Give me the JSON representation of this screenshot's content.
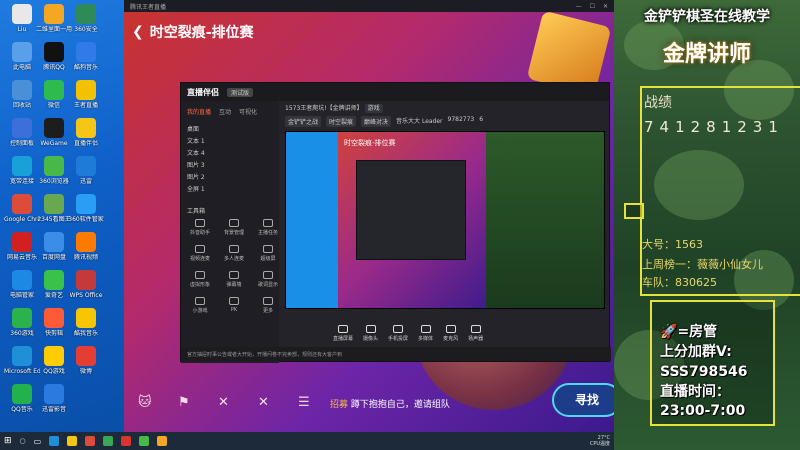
{
  "desktop": {
    "icons": [
      {
        "label": "Liu",
        "color": "#e8e8e8"
      },
      {
        "label": "二维里面一用",
        "color": "#f5a623"
      },
      {
        "label": "360安全",
        "color": "#2e8b57"
      },
      {
        "label": "此电脑",
        "color": "#5aa0e8"
      },
      {
        "label": "腾讯QQ",
        "color": "#111111"
      },
      {
        "label": "酷狗音乐",
        "color": "#2f7be8"
      },
      {
        "label": "回收站",
        "color": "#4a90d9"
      },
      {
        "label": "微信",
        "color": "#2dbb4e"
      },
      {
        "label": "王者直播",
        "color": "#f2c200"
      },
      {
        "label": "控制面板",
        "color": "#3c6fd8"
      },
      {
        "label": "WeGame",
        "color": "#1d1d1d"
      },
      {
        "label": "直播伴侣",
        "color": "#f5c518"
      },
      {
        "label": "宽带连接",
        "color": "#1aa0d8"
      },
      {
        "label": "360浏览器",
        "color": "#48b848"
      },
      {
        "label": "迅雷",
        "color": "#1f7bd8"
      },
      {
        "label": "Google Chrome",
        "color": "#dd4b39"
      },
      {
        "label": "2345看图王",
        "color": "#6aa84f"
      },
      {
        "label": "360软件管家",
        "color": "#2a9df4"
      },
      {
        "label": "网易云音乐",
        "color": "#d21f1f"
      },
      {
        "label": "百度网盘",
        "color": "#3b8ee8"
      },
      {
        "label": "腾讯视频",
        "color": "#ff7a00"
      },
      {
        "label": "电脑管家",
        "color": "#1e88e5"
      },
      {
        "label": "爱奇艺",
        "color": "#39c24a"
      },
      {
        "label": "WPS Office",
        "color": "#c43a3a"
      },
      {
        "label": "360游戏",
        "color": "#2bb24c"
      },
      {
        "label": "快剪辑",
        "color": "#ff5a36"
      },
      {
        "label": "酷我音乐",
        "color": "#f6c600"
      },
      {
        "label": "Microsoft Edge",
        "color": "#1f8fd8"
      },
      {
        "label": "QQ游戏",
        "color": "#ffcc00"
      },
      {
        "label": "微博",
        "color": "#e43d33"
      },
      {
        "label": "QQ音乐",
        "color": "#22b14c"
      },
      {
        "label": "迅雷影音",
        "color": "#2a7be0"
      }
    ]
  },
  "game": {
    "window_title": "腾讯王者直播",
    "back_icon": "chevron-left-icon",
    "title": "时空裂痕-排位赛",
    "invite_prefix": "招募",
    "invite_text": "蹲下抱抱自己，邀请组队",
    "match_button": "寻找"
  },
  "stream_app": {
    "logo": "直播伴侣",
    "version_badge": "测试版",
    "tabs": [
      "我的直播",
      "互动",
      "可视化"
    ],
    "sources": [
      "桌面",
      "文本 1",
      "文本 4",
      "图片 3",
      "图片 2",
      "全屏 1"
    ],
    "tools_title": "工具箱",
    "tools": [
      "抖音助手",
      "背景管理",
      "主播任务",
      "视频连麦",
      "多人连麦",
      "超级屏",
      "虚拟形象",
      "弹幕墙",
      "歌词显示",
      "小游戏",
      "PK",
      "更多"
    ],
    "room_title": "1573王者爬坑!【金牌讲师】",
    "room_tag": "游戏",
    "tags": [
      "金铲铲之战",
      "时空裂痕",
      "巅峰对决"
    ],
    "stats_text": "音乐大大 Leader",
    "viewers": "9782773",
    "likes": "6",
    "preview_title": "时空裂痕-排位赛",
    "controls": [
      "直播屏幕",
      "摄像头",
      "手机投屏",
      "多媒体",
      "麦克风",
      "扬声器"
    ],
    "notice": "官方抽屉时事公告或者大开始，开播问卷不完卖部，规则还有大客户到"
  },
  "panel": {
    "top_text": "金铲铲棋圣在线教学",
    "lecturer": "金牌讲师",
    "record_label": "战绩",
    "record_number": "741281231",
    "big_account": "大号：1563",
    "weekly_rank": "上周榜一：薇薇小仙女儿",
    "team": "车队：830625",
    "room_title": "=房管",
    "group_label": "上分加群V:",
    "group_id": "SSS798546",
    "time_label": "直播时间：",
    "time_value": "23:00-7:00"
  },
  "taskbar": {
    "temp": "27°C",
    "cpu": "CPU温度"
  }
}
